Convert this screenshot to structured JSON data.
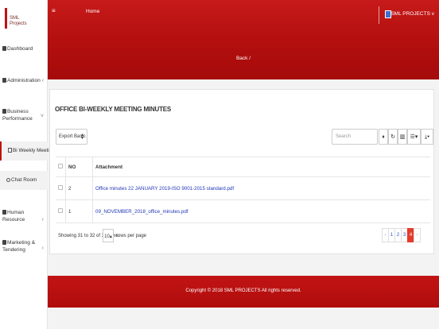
{
  "brand": {
    "line1": "SML",
    "line2": "Projects"
  },
  "sidebar": {
    "items": [
      {
        "label": "Dashboard",
        "icon": "home-icon"
      },
      {
        "label": "Administration",
        "icon": "briefcase-icon"
      },
      {
        "label": "Business",
        "label2": "Performance",
        "icon": "bar-chart-icon"
      },
      {
        "label": "Bi Weekly Meetings",
        "icon": "document-icon"
      },
      {
        "label": "Chat Room",
        "icon": "chat-icon"
      },
      {
        "label": "Human Resource",
        "icon": "users-icon"
      },
      {
        "label": "Marketing &",
        "label2": "Tendering",
        "icon": "file-icon"
      }
    ]
  },
  "header": {
    "home": "Home",
    "user": "SML PROJECTS v"
  },
  "banner": {
    "text": "Back /"
  },
  "card": {
    "title": "OFFICE BI-WEEKLY MEETING MINUTES",
    "export_label": "Export Basic",
    "search_placeholder": "Search"
  },
  "table": {
    "headers": [
      "NO",
      "Attachment"
    ],
    "rows": [
      {
        "no": "2",
        "attachment": "Office minutes 22 JANUARY 2019-ISO 9001-2015 standard.pdf"
      },
      {
        "no": "1",
        "attachment": "09_NOVEMBER_2018_office_minutes.pdf"
      }
    ]
  },
  "pagination": {
    "showing": "Showing 31 to 32 of 32 rows",
    "per_page_value": "10",
    "per_page_label": "rows per page",
    "pages": [
      "‹",
      "1",
      "2",
      "3",
      "4",
      "›"
    ],
    "active": "4"
  },
  "footer": {
    "text": "Copyright © 2018 SML PROJECTS All rights reserved."
  },
  "colors": {
    "primary": "#b51010",
    "accent": "#e53b2c",
    "link": "#2136b8"
  }
}
